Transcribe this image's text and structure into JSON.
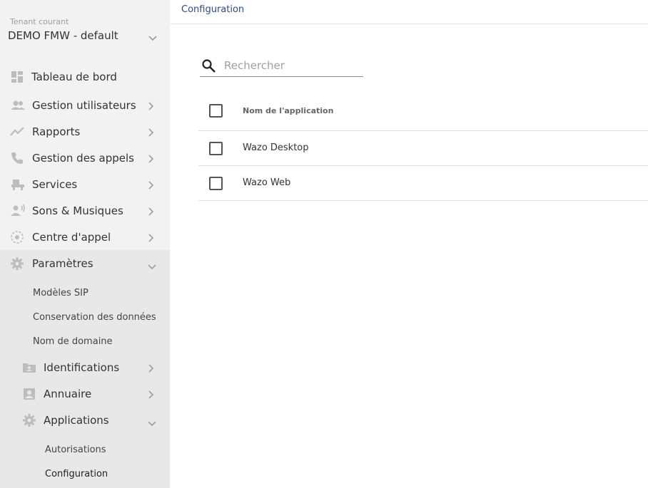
{
  "sidebar": {
    "tenant_label": "Tenant courant",
    "tenant_value": "DEMO FMW - default",
    "items": [
      {
        "label": "Tableau de bord",
        "icon": "dashboard-icon"
      },
      {
        "label": "Gestion utilisateurs",
        "icon": "users-icon"
      },
      {
        "label": "Rapports",
        "icon": "chart-line-icon"
      },
      {
        "label": "Gestion des appels",
        "icon": "phone-icon"
      },
      {
        "label": "Services",
        "icon": "service-bell-icon"
      },
      {
        "label": "Sons & Musiques",
        "icon": "voice-icon"
      },
      {
        "label": "Centre d'appel",
        "icon": "target-icon"
      },
      {
        "label": "Paramètres",
        "icon": "gear-icon"
      }
    ],
    "settings_sub": [
      {
        "label": "Modèles SIP"
      },
      {
        "label": "Conservation des données"
      },
      {
        "label": "Nom de domaine"
      }
    ],
    "settings_sub_groups": [
      {
        "label": "Identifications",
        "icon": "folder-id-icon"
      },
      {
        "label": "Annuaire",
        "icon": "contact-card-icon"
      },
      {
        "label": "Applications",
        "icon": "gear-icon"
      }
    ],
    "applications_sub": [
      {
        "label": "Autorisations"
      },
      {
        "label": "Configuration"
      }
    ]
  },
  "header": {
    "breadcrumb": "Configuration"
  },
  "search": {
    "placeholder": "Rechercher",
    "value": ""
  },
  "table": {
    "column_header": "Nom de l'application",
    "rows": [
      {
        "name": "Wazo Desktop"
      },
      {
        "name": "Wazo Web"
      }
    ]
  },
  "colors": {
    "sidebar_bg": "#f2f2f2",
    "sidebar_active_bg": "#e8e8e8",
    "breadcrumb": "#2c4a8a",
    "icon_gray": "#bdbdbd"
  }
}
